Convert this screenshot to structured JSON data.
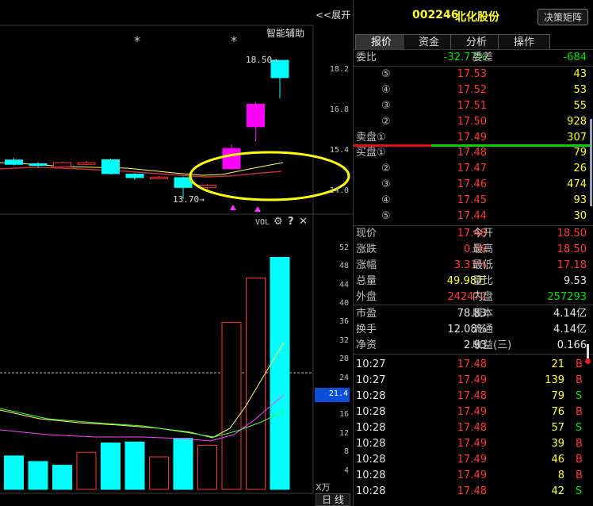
{
  "chart": {
    "expand_label": "<<展开",
    "smart_label": "智能辅助",
    "stars": [
      "*",
      "*"
    ],
    "high_annot": "18.50→",
    "low_annot": "13.70→",
    "price_axis": [
      "18.2",
      "16.8",
      "15.4",
      "14.0"
    ],
    "vol_label": "VOL",
    "vol_axis": [
      "52",
      "48",
      "44",
      "40",
      "36",
      "32",
      "28",
      "24",
      "20",
      "16",
      "12",
      "8",
      "4"
    ],
    "vol_unit": "X万",
    "cursor_value": "21.4",
    "period_label": "日 线",
    "colors": {
      "up": "#ff3333",
      "down": "#00ffff",
      "up_gap": "#ff00ff",
      "ellipse": "#ffff00"
    },
    "price_candles": [
      {
        "o": 15.27,
        "c": 15.0,
        "h": 15.35,
        "l": 14.95,
        "dir": "down"
      },
      {
        "o": 15.05,
        "c": 14.9,
        "h": 15.12,
        "l": 14.86,
        "dir": "down"
      },
      {
        "o": 14.92,
        "c": 14.86,
        "h": 14.98,
        "l": 14.8,
        "dir": "down"
      },
      {
        "o": 14.82,
        "c": 14.96,
        "h": 15.0,
        "l": 14.78,
        "dir": "up"
      },
      {
        "o": 14.9,
        "c": 14.96,
        "h": 15.02,
        "l": 14.86,
        "dir": "up"
      },
      {
        "o": 15.06,
        "c": 14.58,
        "h": 15.1,
        "l": 14.55,
        "dir": "down"
      },
      {
        "o": 14.56,
        "c": 14.44,
        "h": 14.6,
        "l": 14.36,
        "dir": "down"
      },
      {
        "o": 14.46,
        "c": 14.46,
        "h": 14.5,
        "l": 14.42,
        "dir": "up"
      },
      {
        "o": 14.44,
        "c": 14.1,
        "h": 14.48,
        "l": 13.7,
        "dir": "down"
      },
      {
        "o": 14.1,
        "c": 14.18,
        "h": 14.22,
        "l": 14.06,
        "dir": "up"
      },
      {
        "o": 14.75,
        "c": 15.45,
        "h": 15.6,
        "l": 14.7,
        "dir": "up_gap"
      },
      {
        "o": 16.2,
        "c": 16.98,
        "h": 17.05,
        "l": 15.7,
        "dir": "up_gap"
      },
      {
        "o": 17.9,
        "c": 18.5,
        "h": 18.5,
        "l": 17.18,
        "dir": "down"
      }
    ],
    "vol_bars": [
      {
        "v": 9.5,
        "dir": "down"
      },
      {
        "v": 7.2,
        "dir": "down"
      },
      {
        "v": 6.0,
        "dir": "down"
      },
      {
        "v": 5.2,
        "dir": "down"
      },
      {
        "v": 8.0,
        "dir": "up"
      },
      {
        "v": 10.0,
        "dir": "down"
      },
      {
        "v": 10.2,
        "dir": "down"
      },
      {
        "v": 7.0,
        "dir": "up"
      },
      {
        "v": 11.0,
        "dir": "down"
      },
      {
        "v": 9.5,
        "dir": "up"
      },
      {
        "v": 36.0,
        "dir": "up"
      },
      {
        "v": 45.5,
        "dir": "up"
      },
      {
        "v": 49.98,
        "dir": "down"
      }
    ]
  },
  "header": {
    "code": "002246",
    "name": "北化股份",
    "matrix_button": "决策矩阵"
  },
  "tabs": [
    "报价",
    "资金",
    "分析",
    "操作"
  ],
  "weibi": {
    "label": "委比",
    "value": "-32.77%",
    "label2": "委差",
    "value2": "-684"
  },
  "asks": [
    {
      "num": "⑤",
      "price": "17.53",
      "vol": "43"
    },
    {
      "num": "④",
      "price": "17.52",
      "vol": "53"
    },
    {
      "num": "③",
      "price": "17.51",
      "vol": "55"
    },
    {
      "num": "②",
      "price": "17.50",
      "vol": "928"
    },
    {
      "num": "卖盘①",
      "price": "17.49",
      "vol": "307"
    }
  ],
  "bids": [
    {
      "num": "买盘①",
      "price": "17.48",
      "vol": "79"
    },
    {
      "num": "②",
      "price": "17.47",
      "vol": "26"
    },
    {
      "num": "③",
      "price": "17.46",
      "vol": "474"
    },
    {
      "num": "④",
      "price": "17.45",
      "vol": "93"
    },
    {
      "num": "⑤",
      "price": "17.44",
      "vol": "30"
    }
  ],
  "quote": [
    {
      "l1": "现价",
      "v1": "17.48",
      "c1": "red",
      "l2": "今开",
      "v2": "18.50",
      "c2": "red"
    },
    {
      "l1": "涨跌",
      "v1": "0.56",
      "c1": "red",
      "l2": "最高",
      "v2": "18.50",
      "c2": "red"
    },
    {
      "l1": "涨幅",
      "v1": "3.31%",
      "c1": "red",
      "l2": "最低",
      "v2": "17.18",
      "c2": "red"
    },
    {
      "l1": "总量",
      "v1": "49.98万",
      "c1": "yellow",
      "l2": "量比",
      "v2": "9.53",
      "c2": "white"
    },
    {
      "l1": "外盘",
      "v1": "242472",
      "c1": "red",
      "l2": "内盘",
      "v2": "257293",
      "c2": "green"
    }
  ],
  "fundamentals": [
    {
      "l1": "市盈",
      "v1": "78.83",
      "l2": "股本",
      "v2": "4.14亿"
    },
    {
      "l1": "换手",
      "v1": "12.08%",
      "l2": "流通",
      "v2": "4.14亿"
    },
    {
      "l1": "净资",
      "v1": "2.93",
      "l2": "收益(三)",
      "v2": "0.166"
    }
  ],
  "ticks": [
    {
      "time": "10:27",
      "price": "17.48",
      "vol": "21",
      "side": "B"
    },
    {
      "time": "10:27",
      "price": "17.49",
      "vol": "139",
      "side": "B"
    },
    {
      "time": "10:28",
      "price": "17.48",
      "vol": "79",
      "side": "S"
    },
    {
      "time": "10:28",
      "price": "17.49",
      "vol": "76",
      "side": "B"
    },
    {
      "time": "10:28",
      "price": "17.48",
      "vol": "57",
      "side": "S"
    },
    {
      "time": "10:28",
      "price": "17.49",
      "vol": "39",
      "side": "B"
    },
    {
      "time": "10:28",
      "price": "17.49",
      "vol": "46",
      "side": "B"
    },
    {
      "time": "10:28",
      "price": "17.49",
      "vol": "8",
      "side": "B"
    },
    {
      "time": "10:28",
      "price": "17.48",
      "vol": "42",
      "side": "S"
    }
  ]
}
